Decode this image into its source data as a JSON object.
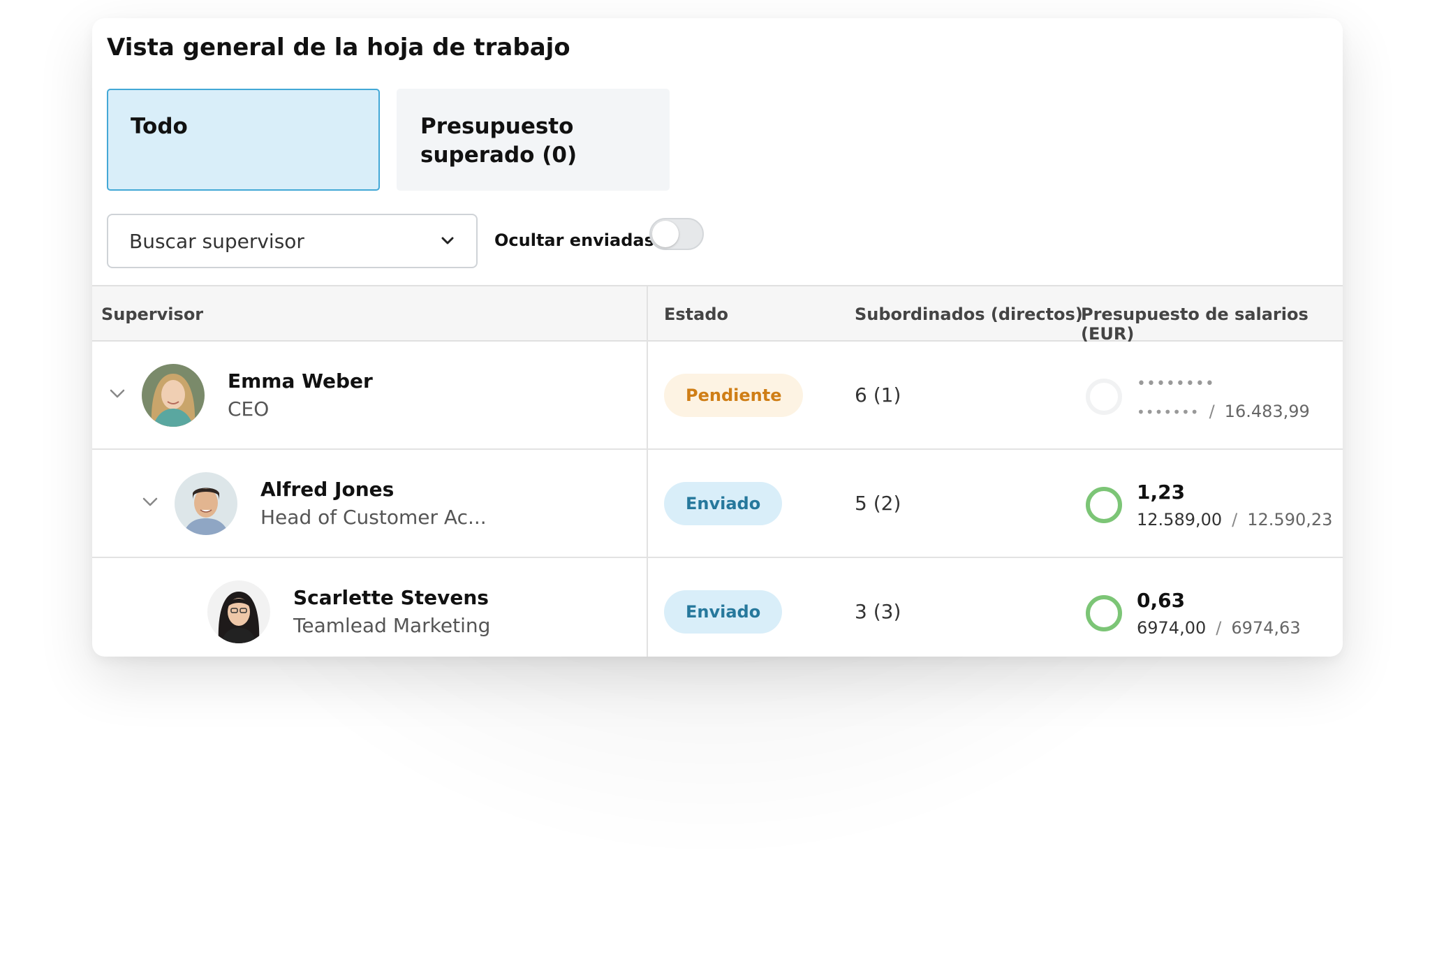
{
  "header": {
    "title": "Vista general de la hoja de trabajo"
  },
  "tabs": [
    {
      "label": "Todo",
      "active": true
    },
    {
      "label": "Presupuesto superado (0)",
      "active": false
    }
  ],
  "filters": {
    "supervisor_select": {
      "value": "Buscar supervisor"
    },
    "hide_sent": {
      "label": "Ocultar enviadas",
      "checked": false
    }
  },
  "table": {
    "columns": [
      "Supervisor",
      "Estado",
      "Subordinados (directos)",
      "Presupuesto de salarios (EUR)"
    ],
    "rows": [
      {
        "name": "Emma Weber",
        "role": "CEO",
        "status": "Pendiente",
        "subordinates": "6 (1)",
        "budget_top": "••••••••",
        "budget_used": "•••••••",
        "budget_total": "16.483,99",
        "masked": true
      },
      {
        "name": "Alfred Jones",
        "role": "Head of Customer Ac...",
        "status": "Enviado",
        "subordinates": "5 (2)",
        "budget_top": "1,23",
        "budget_used": "12.589,00",
        "budget_total": "12.590,23",
        "masked": false
      },
      {
        "name": "Scarlette Stevens",
        "role": "Teamlead Marketing",
        "status": "Enviado",
        "subordinates": "3 (3)",
        "budget_top": "0,63",
        "budget_used": "6974,00",
        "budget_total": "6974,63",
        "masked": false
      }
    ]
  },
  "separator": "/",
  "colors": {
    "accent": "#43a8d6",
    "active_tab_bg": "#d9eef9",
    "pending": "#cf7e16",
    "sent": "#26789c",
    "ring_ok": "#7cc576"
  },
  "icons": [
    "chevron-down-icon",
    "expand-chevron-icon",
    "avatar",
    "progress-ring-icon"
  ]
}
